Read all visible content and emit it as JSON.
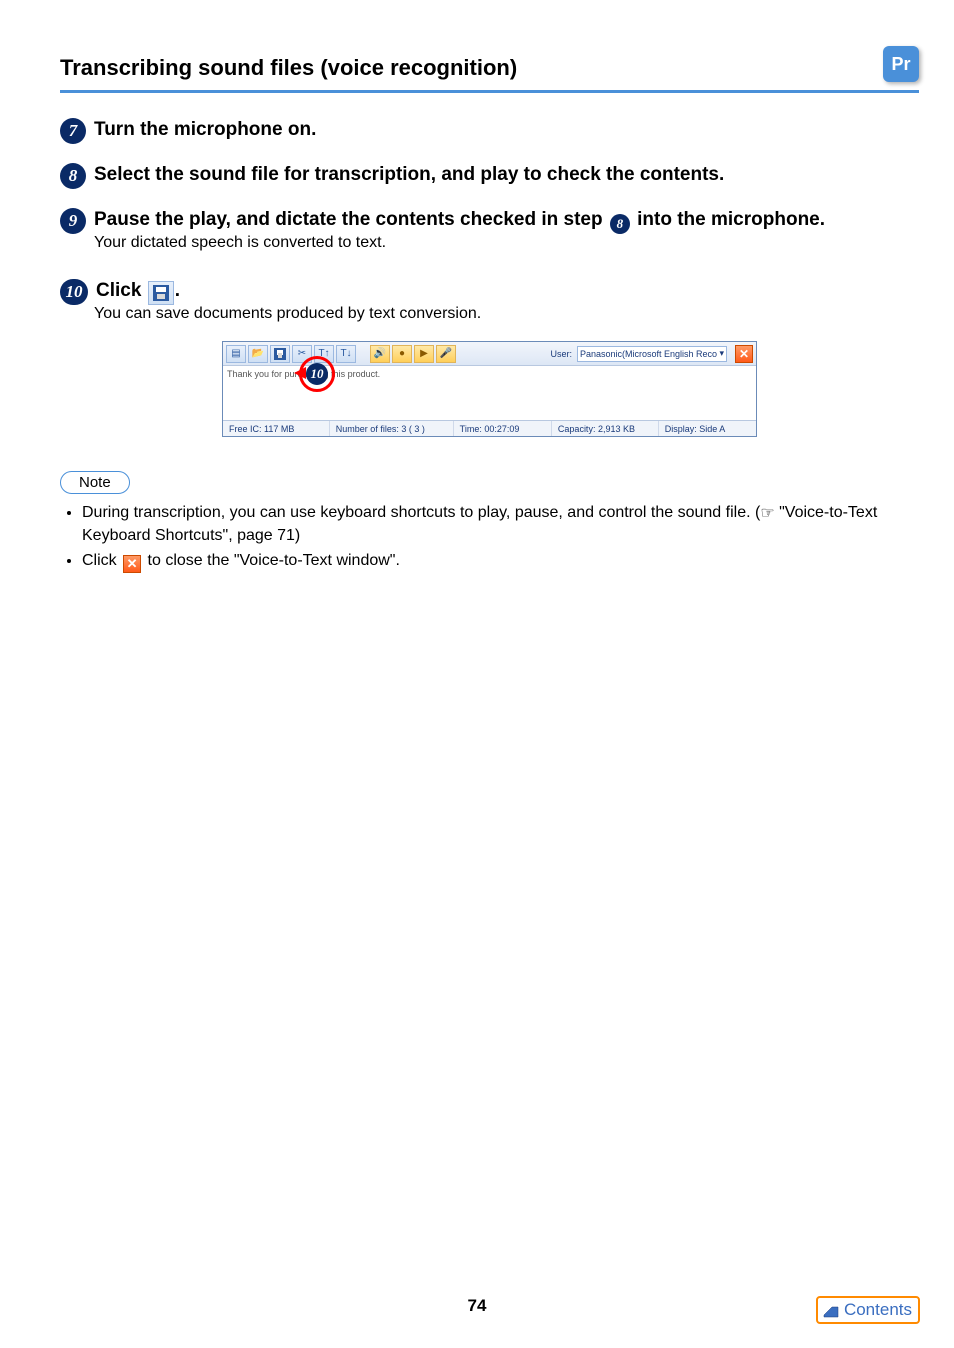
{
  "header": {
    "title": "Transcribing sound files (voice recognition)",
    "badge": "Pr"
  },
  "steps": {
    "s7": {
      "num": "7",
      "text": "Turn the microphone on."
    },
    "s8": {
      "num": "8",
      "text": "Select the sound file for transcription, and play to check the contents."
    },
    "s9": {
      "num": "9",
      "text_a": "Pause the play, and dictate the contents checked in step ",
      "ref_num": "8",
      "text_b": " into the microphone.",
      "body": "Your dictated speech is converted to text."
    },
    "s10": {
      "num": "10",
      "text_a": "Click ",
      "text_b": ".",
      "body": "You can save documents produced by text conversion."
    }
  },
  "screenshot": {
    "callout_num": "10",
    "body_text": "Thank you for purchasing this product.",
    "user_label": "User:",
    "user_value": "Panasonic(Microsoft English Reco",
    "status": {
      "free": "Free IC: 117 MB",
      "files": "Number of files: 3 ( 3 )",
      "time": "Time: 00:27:09",
      "capacity": "Capacity:   2,913 KB",
      "display": "Display:    Side A"
    }
  },
  "note": {
    "label": "Note",
    "item1_a": "During transcription, you can use keyboard shortcuts to play, pause, and control the sound file. (",
    "item1_b": " \"Voice-to-Text Keyboard Shortcuts\", page 71)",
    "item2_a": "Click ",
    "item2_b": " to close the \"Voice-to-Text window\"."
  },
  "footer": {
    "page_number": "74",
    "contents_label": "Contents"
  }
}
